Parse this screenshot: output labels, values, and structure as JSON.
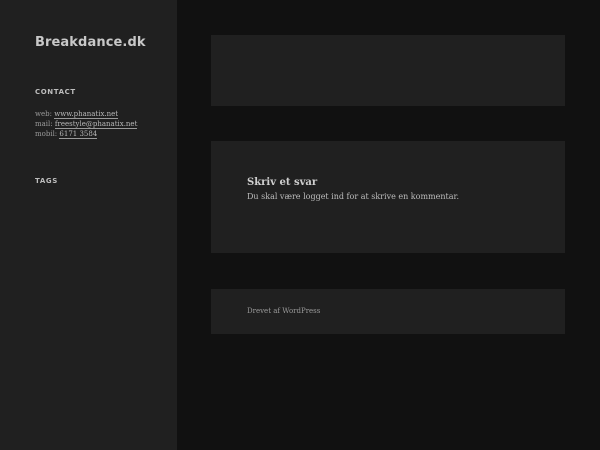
{
  "site": {
    "title": "Breakdance.dk"
  },
  "sidebar": {
    "contact": {
      "title": "CONTACT",
      "web_label": "web:",
      "web_value": "www.phanatix.net",
      "mail_label": "mail:",
      "mail_value": "freestyle@phanatix.net",
      "mobil_label": "mobil:",
      "mobil_value": "6171 3584"
    },
    "tags": {
      "title": "TAGS"
    }
  },
  "comments": {
    "title": "Skriv et svar",
    "note": "Du skal være logget ind for at skrive en kommentar."
  },
  "footer": {
    "credit": "Drevet af WordPress"
  }
}
